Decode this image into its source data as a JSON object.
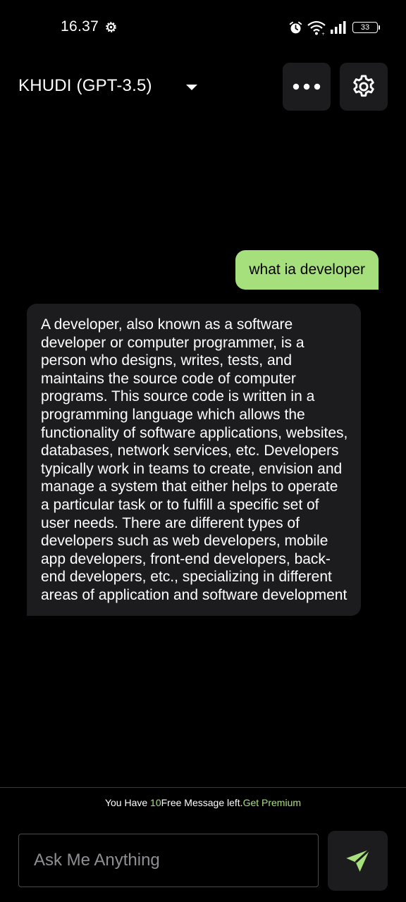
{
  "status_bar": {
    "time": "16.37",
    "battery": "33",
    "icons": [
      "gear-icon",
      "alarm-icon",
      "wifi-icon",
      "signal-icon",
      "battery-icon"
    ]
  },
  "header": {
    "title": "KHUDI (GPT-3.5)",
    "icons": [
      "dropdown-caret-icon",
      "more-dots-icon",
      "settings-gear-icon"
    ]
  },
  "chat": {
    "messages": [
      {
        "role": "user",
        "text": "what ia developer"
      },
      {
        "role": "assistant",
        "text": "A developer, also known as a software developer or computer programmer, is a person who designs, writes, tests, and maintains the source code of computer programs. This source code is written in a programming language which allows the functionality of software applications, websites, databases, network services, etc. Developers typically work in teams to create, envision and manage a system that either helps to operate a particular task or to fulfill a specific set of user needs. There are different types of developers such as web developers, mobile app developers, front-end developers, back-end developers, etc., specializing in different areas of application and software development"
      }
    ]
  },
  "footer": {
    "quota_prefix": "You Have ",
    "quota_count": "10",
    "quota_suffix": "Free Message left.",
    "premium_link": "Get Premium",
    "input_placeholder": "Ask Me Anything",
    "send_icon": "send-icon"
  },
  "colors": {
    "background": "#000000",
    "surface": "#1c1c1e",
    "accent": "#a6e07c",
    "placeholder": "#8e8e93"
  }
}
